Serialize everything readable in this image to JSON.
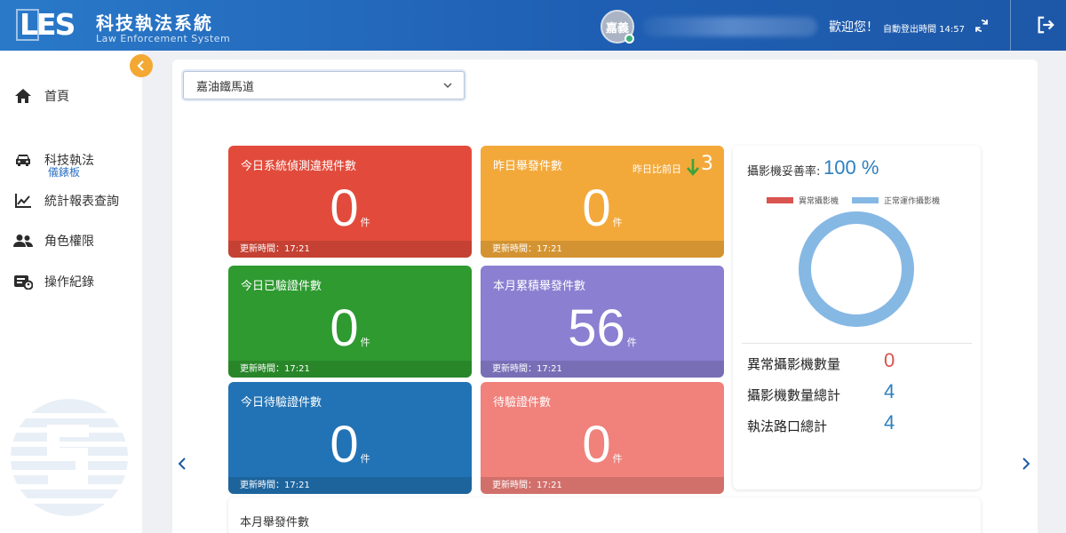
{
  "app": {
    "logo_mark": "LES",
    "title": "科技執法系統",
    "subtitle": "Law Enforcement System"
  },
  "header": {
    "avatar_text": "嘉義",
    "welcome": "歡迎您！",
    "auto_logout_label": "自動登出時間",
    "auto_logout_time": "14:57",
    "icons": [
      "refresh-icon",
      "logout-icon"
    ]
  },
  "sidebar": {
    "collapse_icon": "chevron-left-icon",
    "items": [
      {
        "label": "首頁",
        "icon": "home-icon"
      },
      {
        "label": "科技執法",
        "icon": "car-icon"
      },
      {
        "label": "統計報表查詢",
        "icon": "chart-line-icon"
      },
      {
        "label": "角色權限",
        "icon": "users-icon"
      },
      {
        "label": "操作紀錄",
        "icon": "log-icon"
      }
    ],
    "sub_item": "儀錶板"
  },
  "filter": {
    "selected": "嘉油鐵馬道"
  },
  "cards": [
    {
      "title": "今日系統偵測違規件數",
      "value": "0",
      "unit": "件",
      "update": "更新時間：17:21",
      "color": "#e24b3b"
    },
    {
      "title": "昨日舉發件數",
      "value": "0",
      "unit": "件",
      "update": "更新時間：17:21",
      "color": "#f3a93a",
      "compare_label": "昨日比前日",
      "compare_value": "3",
      "compare_direction": "down"
    },
    {
      "title": "今日已驗證件數",
      "value": "0",
      "unit": "件",
      "update": "更新時間：17:21",
      "color": "#2e9a30"
    },
    {
      "title": "本月累積舉發件數",
      "value": "56",
      "unit": "件",
      "update": "更新時間：17:21",
      "color": "#8a7fd1"
    },
    {
      "title": "今日待驗證件數",
      "value": "0",
      "unit": "件",
      "update": "更新時間：17:21",
      "color": "#2273b5"
    },
    {
      "title": "待驗證件數",
      "value": "0",
      "unit": "件",
      "update": "更新時間：17:21",
      "color": "#f0817b"
    }
  ],
  "camera": {
    "rate_label": "攝影機妥善率:",
    "rate_value": "100 %",
    "legend_abnormal": "異常攝影機",
    "legend_normal": "正常運作攝影機",
    "color_abnormal": "#d9534f",
    "color_normal": "#86b8e4",
    "normal_fraction": 1,
    "stats": [
      {
        "label": "異常攝影機數量",
        "value": "0",
        "color": "#d9534f"
      },
      {
        "label": "攝影機數量總計",
        "value": "4",
        "color": "#2d7fbf"
      },
      {
        "label": "執法路口總計",
        "value": "4",
        "color": "#2d7fbf"
      }
    ]
  },
  "bottom": {
    "title": "本月舉發件數"
  }
}
